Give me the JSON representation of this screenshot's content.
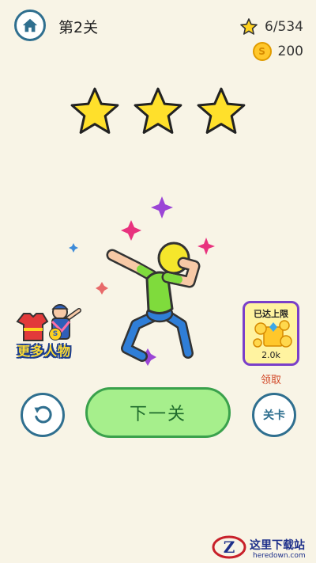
{
  "header": {
    "level_title": "第2关",
    "stars_progress": "6/534",
    "coins": "200",
    "coin_symbol": "S"
  },
  "level_stars": {
    "earned": 3,
    "total": 3
  },
  "promo": {
    "label": "更多人物",
    "badge_letter": "S"
  },
  "reward": {
    "status": "已达上限",
    "value": "2.0k",
    "claim_label": "领取"
  },
  "actions": {
    "next_label": "下一关",
    "levels_label": "关卡"
  },
  "watermark": {
    "main": "这里下载站",
    "sub": "heredown.com"
  },
  "colors": {
    "background": "#f8f4e6",
    "star": "#ffe02b",
    "button_green": "#a6ef8c",
    "button_border": "#3aa14c",
    "icon_blue": "#2f6f8f",
    "card_border": "#7a3fc9"
  }
}
